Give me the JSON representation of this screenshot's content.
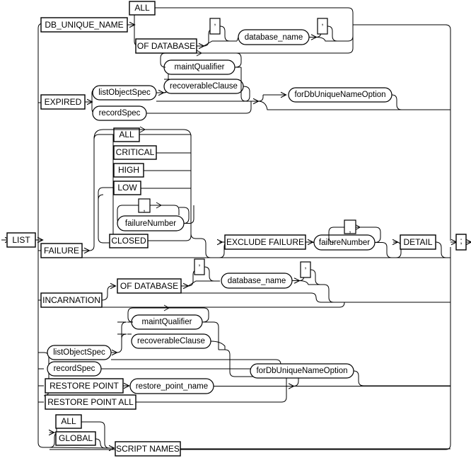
{
  "diagram": {
    "title": "LIST railroad syntax diagram",
    "type": "railroad-syntax-diagram",
    "start_keyword": "LIST",
    "terminator": ";",
    "colors": {
      "stroke": "#000000",
      "background": "#ffffff"
    },
    "keywords": {
      "list": "LIST",
      "db_unique_name": "DB_UNIQUE_NAME",
      "all_1": "ALL",
      "of_database_1": "OF DATABASE",
      "expired": "EXPIRED",
      "all_2": "ALL",
      "critical": "CRITICAL",
      "high": "HIGH",
      "low": "LOW",
      "closed": "CLOSED",
      "failure": "FAILURE",
      "exclude_failure": "EXCLUDE FAILURE",
      "detail": "DETAIL",
      "incarnation": "INCARNATION",
      "of_database_2": "OF DATABASE",
      "restore_point": "RESTORE POINT",
      "restore_point_all": "RESTORE POINT ALL",
      "all_3": "ALL",
      "global": "GLOBAL",
      "script_names": "SCRIPT NAMES",
      "semicolon": ";"
    },
    "nonterminals": {
      "database_name_1": "database_name",
      "database_name_2": "database_name",
      "maint_qualifier_1": "maintQualifier",
      "recoverable_clause_1": "recoverableClause",
      "list_object_spec_1": "listObjectSpec",
      "record_spec_1": "recordSpec",
      "for_db_unique_name_option_1": "forDbUniqueNameOption",
      "failure_number_1": "failureNumber",
      "failure_number_2": "failureNumber",
      "maint_qualifier_2": "maintQualifier",
      "recoverable_clause_2": "recoverableClause",
      "list_object_spec_2": "listObjectSpec",
      "record_spec_2": "recordSpec",
      "restore_point_name": "restore_point_name",
      "for_db_unique_name_option_2": "forDbUniqueNameOption"
    },
    "punctuation": {
      "comma_1": ",",
      "comma_2": ",",
      "comma_3": ",",
      "comma_4": ",",
      "comma_5": ",",
      "comma_6": ","
    }
  }
}
